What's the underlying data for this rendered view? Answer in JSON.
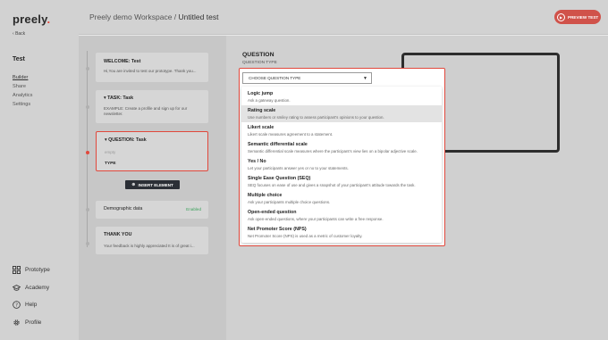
{
  "app": {
    "logo": "preely",
    "back_label": "Back",
    "project_title": "Test"
  },
  "sidebar": {
    "items": [
      {
        "label": "Builder",
        "active": true
      },
      {
        "label": "Share",
        "active": false
      },
      {
        "label": "Analytics",
        "active": false
      },
      {
        "label": "Settings",
        "active": false
      }
    ],
    "bottom": [
      {
        "label": "Prototype",
        "icon": "grid-icon"
      },
      {
        "label": "Academy",
        "icon": "graduation-cap-icon"
      },
      {
        "label": "Help",
        "icon": "help-circle-icon"
      },
      {
        "label": "Profile",
        "icon": "gear-icon"
      }
    ]
  },
  "header": {
    "workspace": "Preely demo Workspace /",
    "test_name": "Untitled test",
    "preview_label": "PREVIEW TEST"
  },
  "flow": {
    "welcome": {
      "title": "WELCOME:  Test",
      "text": "Hi,You are invited to test our prototype. Thank you..."
    },
    "task": {
      "title": "TASK:  Task",
      "text": "EXAMPLE: Create a profile and sign up for our newsletter."
    },
    "question": {
      "title": "QUESTION:  Task",
      "placeholder": "empty",
      "type_label": "TYPE"
    },
    "insert_label": "INSERT ELEMENT",
    "demographic": {
      "title": "Demographic data",
      "status": "Enabled"
    },
    "thankyou": {
      "title": "THANK YOU",
      "text": "Your feedback is highly appreciated It is of great i..."
    }
  },
  "question_panel": {
    "title": "QUESTION",
    "type_label": "QUESTION TYPE",
    "select_placeholder": "CHOOSE QUESTION TYPE",
    "highlighted_index": 1,
    "options": [
      {
        "title": "Logic jump",
        "desc": "Ask a gateway question."
      },
      {
        "title": "Rating scale",
        "desc": "Use numbers or smiley rating to assess participant's opinions to your question."
      },
      {
        "title": "Likert scale",
        "desc": "Likert scale measures agreement to a statement."
      },
      {
        "title": "Semantic differential scale",
        "desc": "Semantic differential scale measures where the participant's view lies on a bipolar adjective scale."
      },
      {
        "title": "Yes / No",
        "desc": "Let your participants answer yes or no to your statements."
      },
      {
        "title": "Single Ease Question (SEQ)",
        "desc": "SEQ focuses on ease of use and gives a snapshot of your participant's attitude towards the task."
      },
      {
        "title": "Multiple choice",
        "desc": "Ask your participants multiple choice questions."
      },
      {
        "title": "Open-ended question",
        "desc": "Ask open-ended questions, where your participants can write a free response."
      },
      {
        "title": "Net Promoter Score (NPS)",
        "desc": "Net Promoter Score (NPS) is used as a metric of customer loyalty."
      }
    ]
  },
  "colors": {
    "accent": "#e1483c",
    "enabled": "#3aa15a",
    "button_dark": "#2b2f36"
  }
}
